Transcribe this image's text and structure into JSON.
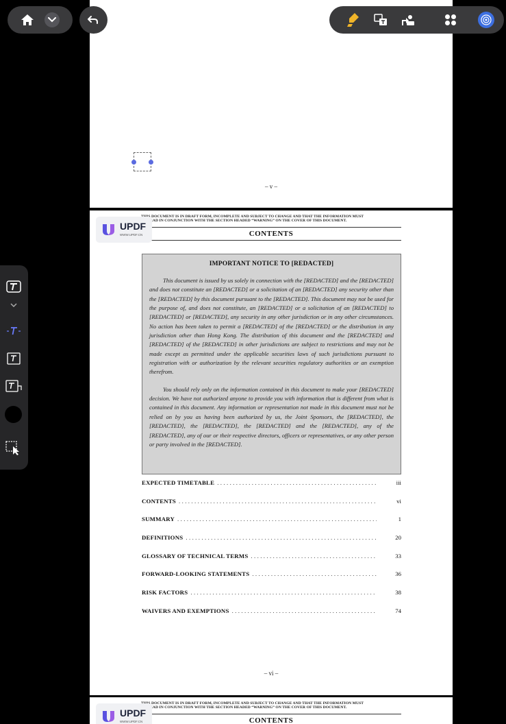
{
  "top_page": {
    "page_number": "– v –"
  },
  "main_page": {
    "draft_notice_line1": "THIS DOCUMENT IS IN DRAFT FORM, INCOMPLETE AND SUBJECT TO CHANGE AND THAT THE INFORMATION MUST",
    "draft_notice_line2": "BE READ IN CONJUNCTION WITH THE SECTION HEADED “WARNING” ON THE COVER OF THIS DOCUMENT.",
    "title": "CONTENTS",
    "watermark": {
      "name": "UPDF",
      "url": "WWW.UPDF.CN"
    },
    "notice": {
      "title": "IMPORTANT NOTICE TO [REDACTED]",
      "paragraph1": "This document is issued by us solely in connection with the [REDACTED] and the [REDACTED] and does not constitute an [REDACTED] or a solicitation of an [REDACTED] any security other than the [REDACTED] by this document pursuant to the [REDACTED]. This document may not be used for the purpose of, and does not constitute, an [REDACTED] or a solicitation of an [REDACTED] to [REDACTED] or [REDACTED], any security in any other jurisdiction or in any other circumstances. No action has been taken to permit a [REDACTED] of the [REDACTED] or the distribution in any jurisdiction other than Hong Kong. The distribution of this document and the [REDACTED] and [REDACTED] of the [REDACTED] in other jurisdictions are subject to restrictions and may not be made except as permitted under the applicable securities laws of such jurisdictions pursuant to registration with or authorization by the relevant securities regulatory authorities or an exemption therefrom.",
      "paragraph2": "You should rely only on the information contained in this document to make your [REDACTED] decision. We have not authorized anyone to provide you with information that is different from what is contained in this document. Any information or representation not made in this document must not be relied on by you as having been authorized by us, the Joint Sponsors, the [REDACTED], the [REDACTED], the [REDACTED], the [REDACTED] and the [REDACTED], any of the [REDACTED], any of our or their respective directors, officers or representatives, or any other person or party involved in the [REDACTED]."
    },
    "toc": [
      {
        "label": "EXPECTED TIMETABLE",
        "page": "iii"
      },
      {
        "label": "CONTENTS",
        "page": "vi"
      },
      {
        "label": "SUMMARY",
        "page": "1"
      },
      {
        "label": "DEFINITIONS",
        "page": "20"
      },
      {
        "label": "GLOSSARY OF TECHNICAL TERMS",
        "page": "33"
      },
      {
        "label": "FORWARD-LOOKING STATEMENTS",
        "page": "36"
      },
      {
        "label": "RISK FACTORS",
        "page": "38"
      },
      {
        "label": "WAIVERS AND EXEMPTIONS",
        "page": "74"
      }
    ],
    "toc_leader": "......................................................................................................................",
    "page_number": "– vi –"
  },
  "next_page": {
    "draft_notice_line1": "THIS DOCUMENT IS IN DRAFT FORM, INCOMPLETE AND SUBJECT TO CHANGE AND THAT THE INFORMATION MUST",
    "draft_notice_line2": "BE READ IN CONJUNCTION WITH THE SECTION HEADED “WARNING” ON THE COVER OF THIS DOCUMENT.",
    "title": "CONTENTS",
    "watermark": {
      "name": "UPDF",
      "url": "WWW.UPDF.CN"
    }
  },
  "toolbar": {
    "left_icons": [
      "home-icon",
      "chevron-down-icon",
      "undo-icon"
    ],
    "right_icons": [
      "highlighter-icon",
      "translate-icon",
      "convert-icon",
      "grid-icon",
      "ai-assistant-icon"
    ],
    "highlight_color": "#f0b429",
    "accent_color": "#3d6fe0"
  },
  "side_tools": {
    "icons": [
      "text-tool-icon",
      "chevron-down-icon",
      "text-cursor-icon",
      "text-box-icon",
      "text-callout-icon",
      "color-swatch",
      "select-tool-icon"
    ],
    "active_tool": "text-cursor-icon",
    "active_color": "#6b7cff",
    "swatch_color": "#000000"
  }
}
